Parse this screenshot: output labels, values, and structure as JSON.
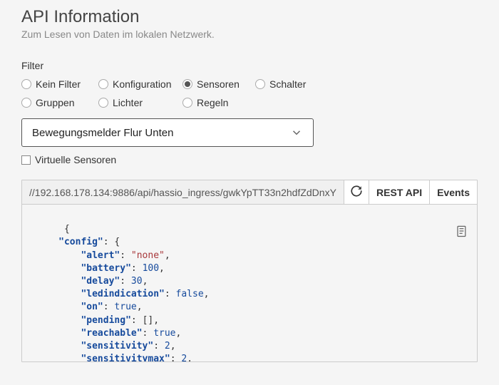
{
  "header": {
    "title": "API Information",
    "subtitle": "Zum Lesen von Daten im lokalen Netzwerk."
  },
  "filter": {
    "label": "Filter",
    "options_row1": [
      {
        "label": "Kein Filter",
        "checked": false
      },
      {
        "label": "Konfiguration",
        "checked": false
      },
      {
        "label": "Sensoren",
        "checked": true
      },
      {
        "label": "Schalter",
        "checked": false
      }
    ],
    "options_row2": [
      {
        "label": "Gruppen",
        "checked": false
      },
      {
        "label": "Lichter",
        "checked": false
      },
      {
        "label": "Regeln",
        "checked": false
      }
    ],
    "select_value": "Bewegungsmelder Flur Unten",
    "virtual_label": "Virtuelle Sensoren",
    "virtual_checked": false
  },
  "api": {
    "url": "//192.168.178.134:9886/api/hassio_ingress/gwkYpTT33n2hdfZdDnxY",
    "rest_label": "REST API",
    "events_label": "Events",
    "json": {
      "config": {
        "alert": "none",
        "battery": 100,
        "delay": 30,
        "ledindication": false,
        "on": true,
        "pending": [],
        "reachable": true,
        "sensitivity": 2,
        "sensitivitymax": 2,
        "usertest": false
      }
    }
  }
}
